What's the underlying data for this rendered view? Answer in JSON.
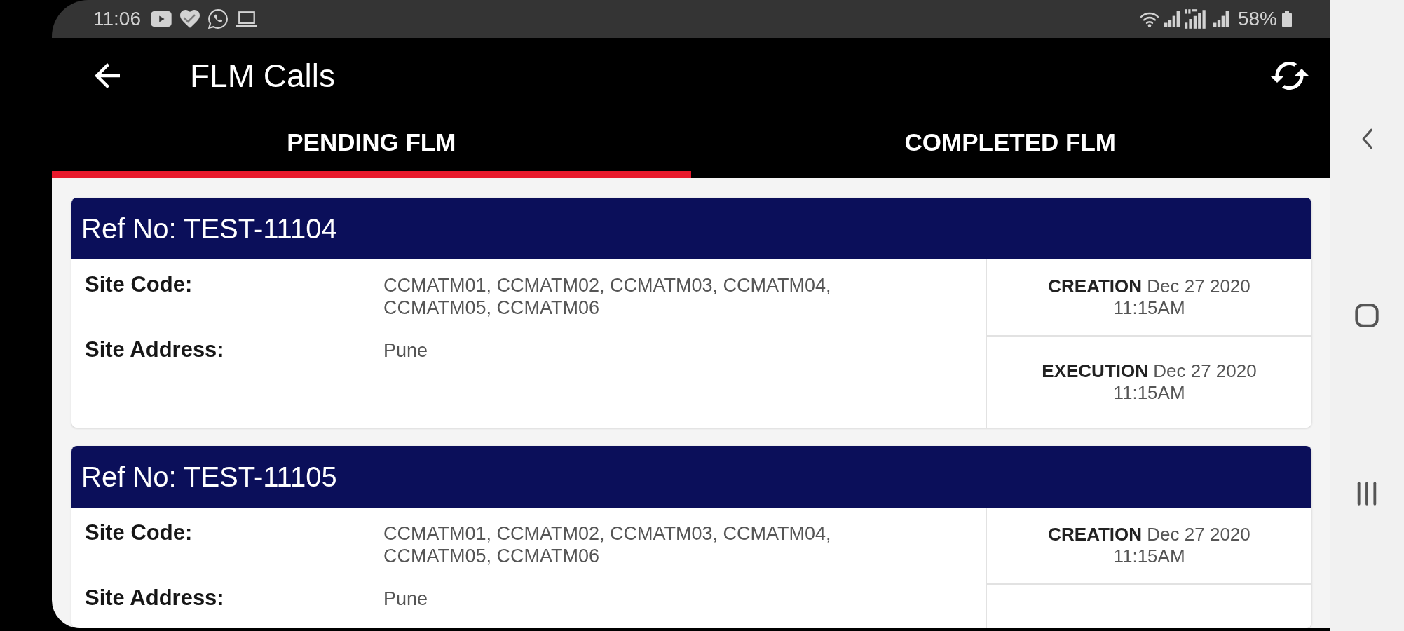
{
  "status_bar": {
    "time": "11:06",
    "battery": "58%"
  },
  "app_bar": {
    "title": "FLM Calls"
  },
  "tabs": [
    {
      "label": "PENDING FLM",
      "selected": true
    },
    {
      "label": "COMPLETED FLM",
      "selected": false
    }
  ],
  "calls": [
    {
      "ref": "Ref No: TEST-11104",
      "fields": [
        {
          "label": "Site Code:",
          "value": "CCMATM01, CCMATM02, CCMATM03, CCMATM04, CCMATM05, CCMATM06"
        },
        {
          "label": "Site Address:",
          "value": "Pune"
        }
      ],
      "dates": [
        "**CREATION** Dec 27 2020 11:15AM",
        "**EXECUTION** Dec 27 2020 11:15AM"
      ]
    },
    {
      "ref": "Ref No: TEST-11105",
      "fields": [
        {
          "label": "Site Code:",
          "value": "CCMATM01, CCMATM02, CCMATM03, CCMATM04, CCMATM05, CCMATM06"
        },
        {
          "label": "Site Address:",
          "value": "Pune"
        }
      ],
      "dates": [
        "**CREATION** Dec 27 2020 11:15AM"
      ]
    }
  ]
}
